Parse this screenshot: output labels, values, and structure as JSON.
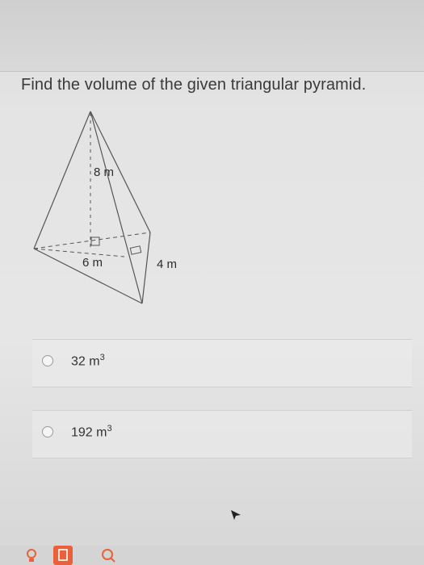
{
  "question": {
    "text": "Find the volume of the given triangular pyramid."
  },
  "figure": {
    "labels": {
      "height": "8 m",
      "base": "6 m",
      "side": "4 m"
    }
  },
  "choices": [
    {
      "value": "32 m",
      "exponent": "3"
    },
    {
      "value": "192 m",
      "exponent": "3"
    }
  ],
  "toolbar": {
    "icons": [
      "lightbulb-icon",
      "document-icon",
      "search-icon"
    ]
  },
  "colors": {
    "accent": "#e8613a",
    "text": "#333333"
  }
}
